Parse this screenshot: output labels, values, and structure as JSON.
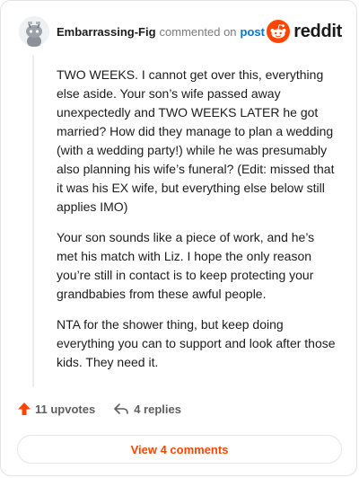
{
  "header": {
    "username": "Embarrassing-Fig",
    "action": "commented on",
    "post_link": "post",
    "logo_text": "reddit"
  },
  "comment": {
    "paragraphs": [
      "TWO WEEKS. I cannot get over this, everything else aside. Your son’s wife passed away unexpectedly and TWO WEEKS LATER he got married? How did they manage to plan a wedding (with a wedding party!) while he was presumably also planning his wife’s funeral? (Edit: missed that it was his EX wife, but everything else below still applies IMO)",
      "Your son sounds like a piece of work, and he’s met his match with Liz. I hope the only reason you’re still in contact is to keep protecting your grandbabies from these awful people.",
      "NTA for the shower thing, but keep doing everything you can to support and look after those kids. They need it."
    ]
  },
  "actions": {
    "upvotes": "11 upvotes",
    "replies": "4 replies"
  },
  "view_button": "View 4 comments",
  "colors": {
    "accent": "#ff4500",
    "link": "#0079d3",
    "muted": "#7c7c7c"
  },
  "icons": {
    "upvote": "arrow-up-icon",
    "reply": "reply-arrow-icon",
    "logo": "reddit-snoo-icon",
    "avatar": "snoo-avatar-icon"
  }
}
